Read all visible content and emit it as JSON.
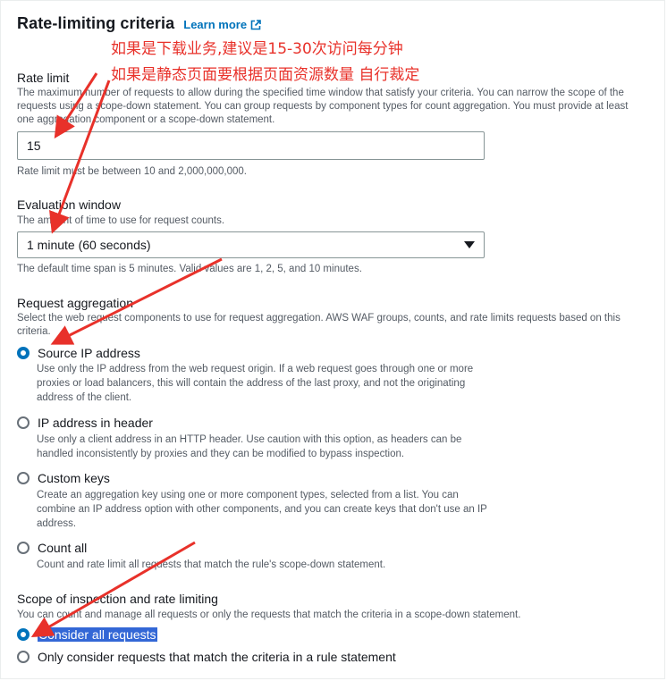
{
  "header": {
    "title": "Rate-limiting criteria",
    "learn_more": "Learn more"
  },
  "annotations": {
    "line1": "如果是下载业务,建议是15-30次访问每分钟",
    "line2": "如果是静态页面要根据页面资源数量 自行裁定",
    "color": "#e8312a"
  },
  "rate_limit": {
    "label": "Rate limit",
    "description": "The maximum number of requests to allow during the specified time window that satisfy your criteria. You can narrow the scope of the requests using a scope-down statement. You can group requests by component types for count aggregation. You must provide at least one aggregation component or a scope-down statement.",
    "value": "15",
    "hint": "Rate limit must be between 10 and 2,000,000,000."
  },
  "evaluation_window": {
    "label": "Evaluation window",
    "description": "The amount of time to use for request counts.",
    "selected": "1 minute (60 seconds)",
    "hint": "The default time span is 5 minutes. Valid values are 1, 2, 5, and 10 minutes."
  },
  "request_aggregation": {
    "label": "Request aggregation",
    "description": "Select the web request components to use for request aggregation. AWS WAF groups, counts, and rate limits requests based on this criteria.",
    "options": [
      {
        "label": "Source IP address",
        "checked": true,
        "description": "Use only the IP address from the web request origin. If a web request goes through one or more proxies or load balancers, this will contain the address of the last proxy, and not the originating address of the client."
      },
      {
        "label": "IP address in header",
        "checked": false,
        "description": "Use only a client address in an HTTP header. Use caution with this option, as headers can be handled inconsistently by proxies and they can be modified to bypass inspection."
      },
      {
        "label": "Custom keys",
        "checked": false,
        "description": "Create an aggregation key using one or more component types, selected from a list. You can combine an IP address option with other components, and you can create keys that don't use an IP address."
      },
      {
        "label": "Count all",
        "checked": false,
        "description": "Count and rate limit all requests that match the rule's scope-down statement."
      }
    ]
  },
  "scope": {
    "label": "Scope of inspection and rate limiting",
    "description": "You can count and manage all requests or only the requests that match the criteria in a scope-down statement.",
    "options": [
      {
        "label": "Consider all requests",
        "checked": true
      },
      {
        "label": "Only consider requests that match the criteria in a rule statement",
        "checked": false
      }
    ]
  },
  "colors": {
    "link": "#0073bb",
    "radio_selected": "#0073bb",
    "text": "#16191f",
    "secondary_text": "#545b64",
    "selection_highlight": "#3367d6"
  }
}
